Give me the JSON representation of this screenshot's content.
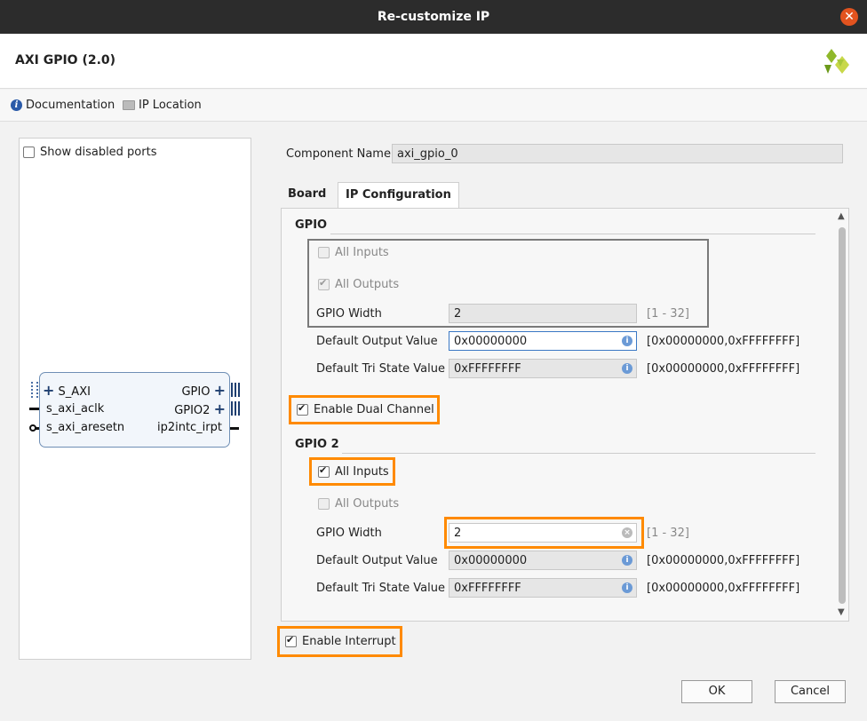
{
  "window": {
    "title": "Re-customize IP"
  },
  "header": {
    "ip_name": "AXI GPIO (2.0)"
  },
  "toolbar": {
    "documentation": "Documentation",
    "ip_location": "IP Location"
  },
  "left_panel": {
    "show_disabled_ports": "Show disabled ports",
    "block": {
      "left_ports": [
        "S_AXI",
        "s_axi_aclk",
        "s_axi_aresetn"
      ],
      "right_ports": [
        "GPIO",
        "GPIO2",
        "ip2intc_irpt"
      ]
    }
  },
  "component": {
    "label": "Component Name",
    "value": "axi_gpio_0"
  },
  "tabs": [
    "Board",
    "IP Configuration"
  ],
  "gpio": {
    "section": "GPIO",
    "all_inputs": "All Inputs",
    "all_outputs": "All Outputs",
    "width_label": "GPIO Width",
    "width_value": "2",
    "width_range": "[1 - 32]",
    "default_output_label": "Default Output Value",
    "default_output_value": "0x00000000",
    "default_output_range": "[0x00000000,0xFFFFFFFF]",
    "tri_state_label": "Default Tri State Value",
    "tri_state_value": "0xFFFFFFFF",
    "tri_state_range": "[0x00000000,0xFFFFFFFF]"
  },
  "enable_dual_channel": "Enable Dual Channel",
  "gpio2": {
    "section": "GPIO 2",
    "all_inputs": "All Inputs",
    "all_outputs": "All Outputs",
    "width_label": "GPIO Width",
    "width_value": "2",
    "width_range": "[1 - 32]",
    "default_output_label": "Default Output Value",
    "default_output_value": "0x00000000",
    "default_output_range": "[0x00000000,0xFFFFFFFF]",
    "tri_state_label": "Default Tri State Value",
    "tri_state_value": "0xFFFFFFFF",
    "tri_state_range": "[0x00000000,0xFFFFFFFF]"
  },
  "enable_interrupt": "Enable Interrupt",
  "buttons": {
    "ok": "OK",
    "cancel": "Cancel"
  },
  "colors": {
    "highlight": "#ff8a00",
    "titlebar": "#2c2c2c",
    "close": "#e2531f",
    "logo": "#8fb82a"
  }
}
